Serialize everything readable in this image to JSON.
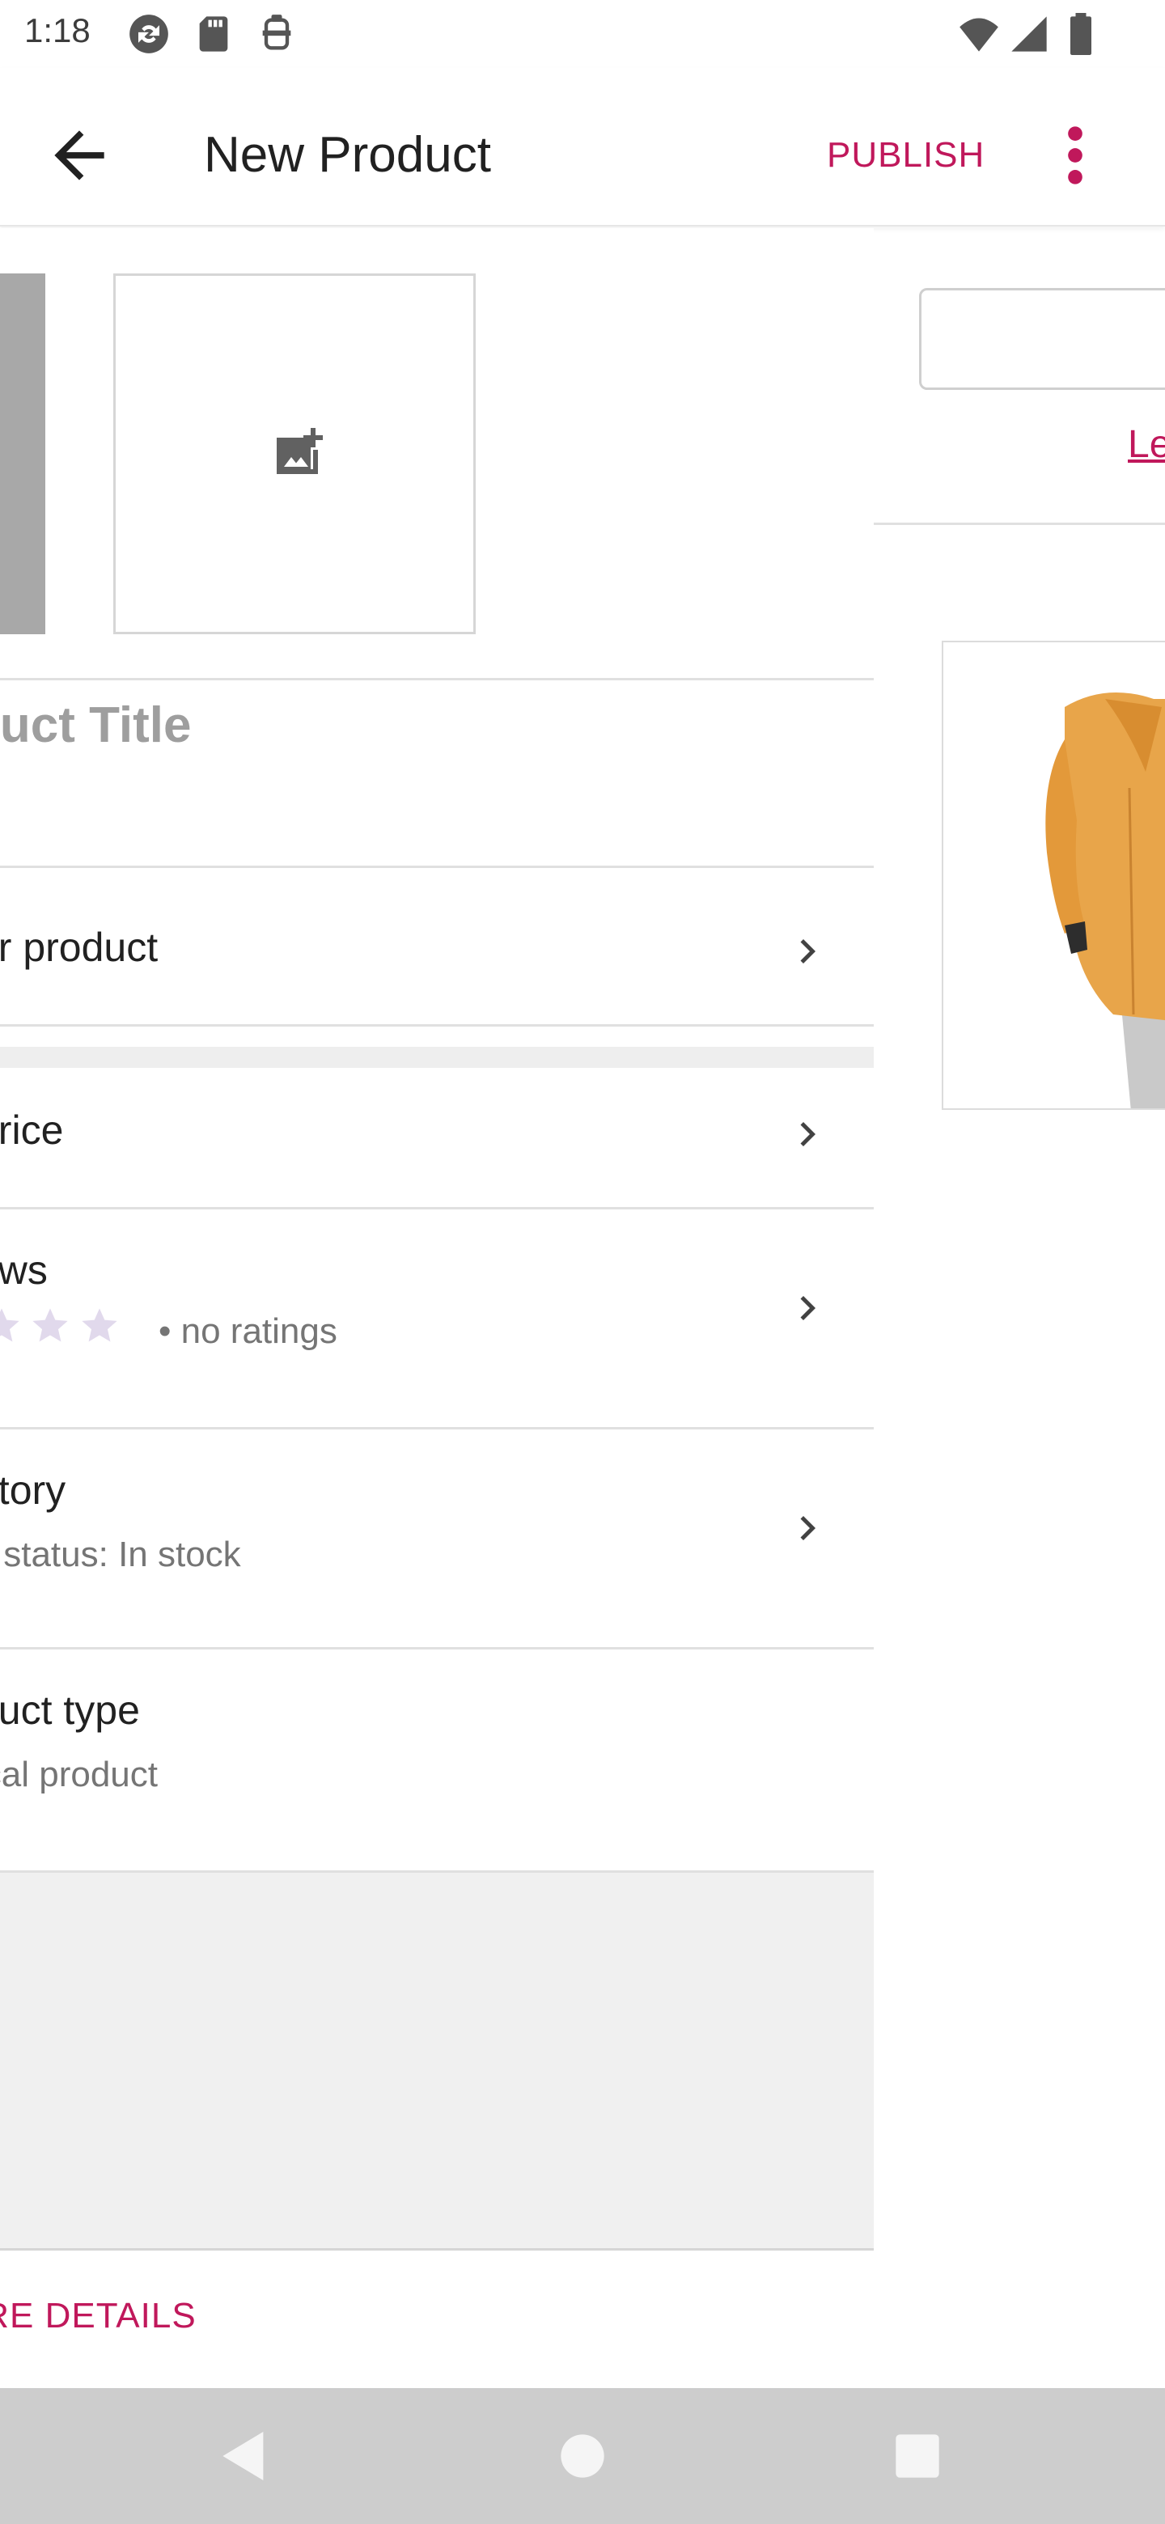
{
  "status_bar": {
    "time": "1:18",
    "icons": [
      "sync-icon",
      "sd-card-icon",
      "vpn-icon"
    ],
    "right_icons": [
      "wifi-icon",
      "signal-icon",
      "battery-icon"
    ]
  },
  "app_bar": {
    "title": "New Product",
    "publish_label": "PUBLISH",
    "back_icon": "arrow-back-icon",
    "more_icon": "more-vert-icon"
  },
  "product": {
    "title_placeholder": "duct Title",
    "rows": [
      {
        "main": "ur product"
      },
      {
        "main": " price"
      },
      {
        "main": "ews",
        "sub": "• no ratings",
        "rating": 0
      },
      {
        "main": "ntory",
        "sub": "k status: In stock"
      },
      {
        "main": "duct type",
        "sub": "ical product"
      }
    ],
    "more_details_label": "ORE DETAILS"
  },
  "right_panel": {
    "link_text": "Le"
  },
  "colors": {
    "accent": "#c0185b",
    "divider": "#e0e0e0",
    "star_empty": "#e1d9ec",
    "jacket": "#e8a54a"
  }
}
